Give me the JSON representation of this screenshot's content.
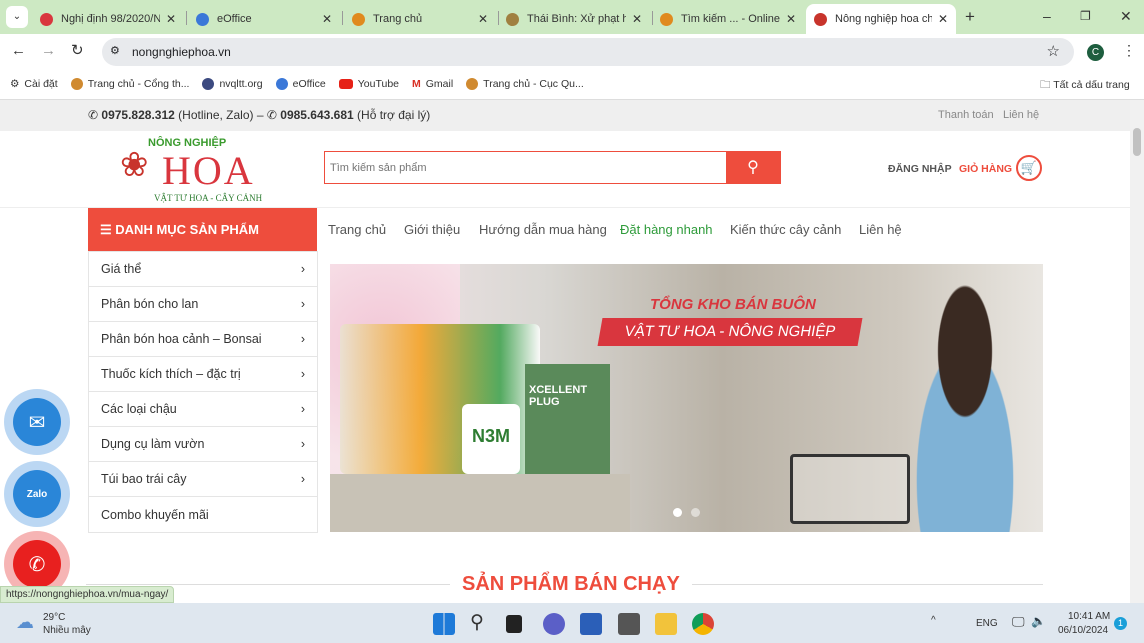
{
  "browser": {
    "tabs": [
      {
        "title": "Nghị định 98/2020/N",
        "icon_color": "#d9363e"
      },
      {
        "title": "eOffice",
        "icon_color": "#3b78d8"
      },
      {
        "title": "Trang chủ",
        "icon_color": "#e08a1e"
      },
      {
        "title": "Thái Bình: Xử phạt hà",
        "icon_color": "#a08040"
      },
      {
        "title": "Tìm kiếm ... - Online",
        "icon_color": "#e08a1e"
      },
      {
        "title": "Nông nghiệp hoa chu",
        "icon_color": "#c8342c",
        "active": true
      }
    ],
    "new_tab": "+",
    "url": "nongnghiephoa.vn",
    "profile_initial": "C",
    "bookmarks": [
      {
        "label": "Cài đặt",
        "icon": "gear-icon"
      },
      {
        "label": "Trang chủ - Cổng th...",
        "icon": "emblem-icon"
      },
      {
        "label": "nvqltt.org",
        "icon": "globe-icon"
      },
      {
        "label": "eOffice",
        "icon": "eoffice-icon"
      },
      {
        "label": "YouTube",
        "icon": "youtube-icon"
      },
      {
        "label": "Gmail",
        "icon": "gmail-icon"
      },
      {
        "label": "Trang chủ - Cục Qu...",
        "icon": "emblem-icon"
      }
    ],
    "all_bookmarks": "Tất cả dấu trang",
    "status_url": "https://nongnghiephoa.vn/mua-ngay/"
  },
  "site": {
    "accent": "#ee4d3d",
    "green": "#2e9b3a",
    "hotline": "0975.828.312",
    "hotline_note": "(Hotline, Zalo) –",
    "agent_phone": "0985.643.681",
    "agent_note": "(Hỗ trợ đại lý)",
    "top_links": [
      "Thanh toán",
      "Liên hệ"
    ],
    "logo": {
      "top": "NÔNG NGHIỆP",
      "main": "HOA",
      "sub": "VẬT TƯ HOA - CÂY CẢNH"
    },
    "search_placeholder": "Tìm kiếm sản phẩm",
    "login": "ĐĂNG NHẬP",
    "cart": "GIỎ HÀNG",
    "category_title": "DANH MỤC SẢN PHẨM",
    "nav": [
      "Trang chủ",
      "Giới thiệu",
      "Hướng dẫn mua hàng",
      "Đặt hàng nhanh",
      "Kiến thức cây cảnh",
      "Liên hệ"
    ],
    "categories": [
      {
        "label": "Giá thể",
        "arrow": true
      },
      {
        "label": "Phân bón cho lan",
        "arrow": true
      },
      {
        "label": "Phân bón hoa cảnh – Bonsai",
        "arrow": true
      },
      {
        "label": "Thuốc kích thích – đặc trị",
        "arrow": true
      },
      {
        "label": "Các loại chậu",
        "arrow": true
      },
      {
        "label": "Dụng cụ làm vườn",
        "arrow": true
      },
      {
        "label": "Túi bao trái cây",
        "arrow": true
      },
      {
        "label": "Combo khuyến mãi",
        "arrow": false
      }
    ],
    "banner": {
      "line1": "TỔNG KHO BÁN BUÔN",
      "line2": "VẬT TƯ HOA - NÔNG NGHIỆP",
      "product1": "XCELLENT PLUG",
      "product2": "N3M"
    },
    "section_title": "SẢN PHẨM BÁN CHẠY"
  },
  "taskbar": {
    "temp": "29°C",
    "weather": "Nhiều mây",
    "lang": "ENG",
    "time": "10:41 AM",
    "date": "06/10/2024",
    "notif": "1"
  }
}
